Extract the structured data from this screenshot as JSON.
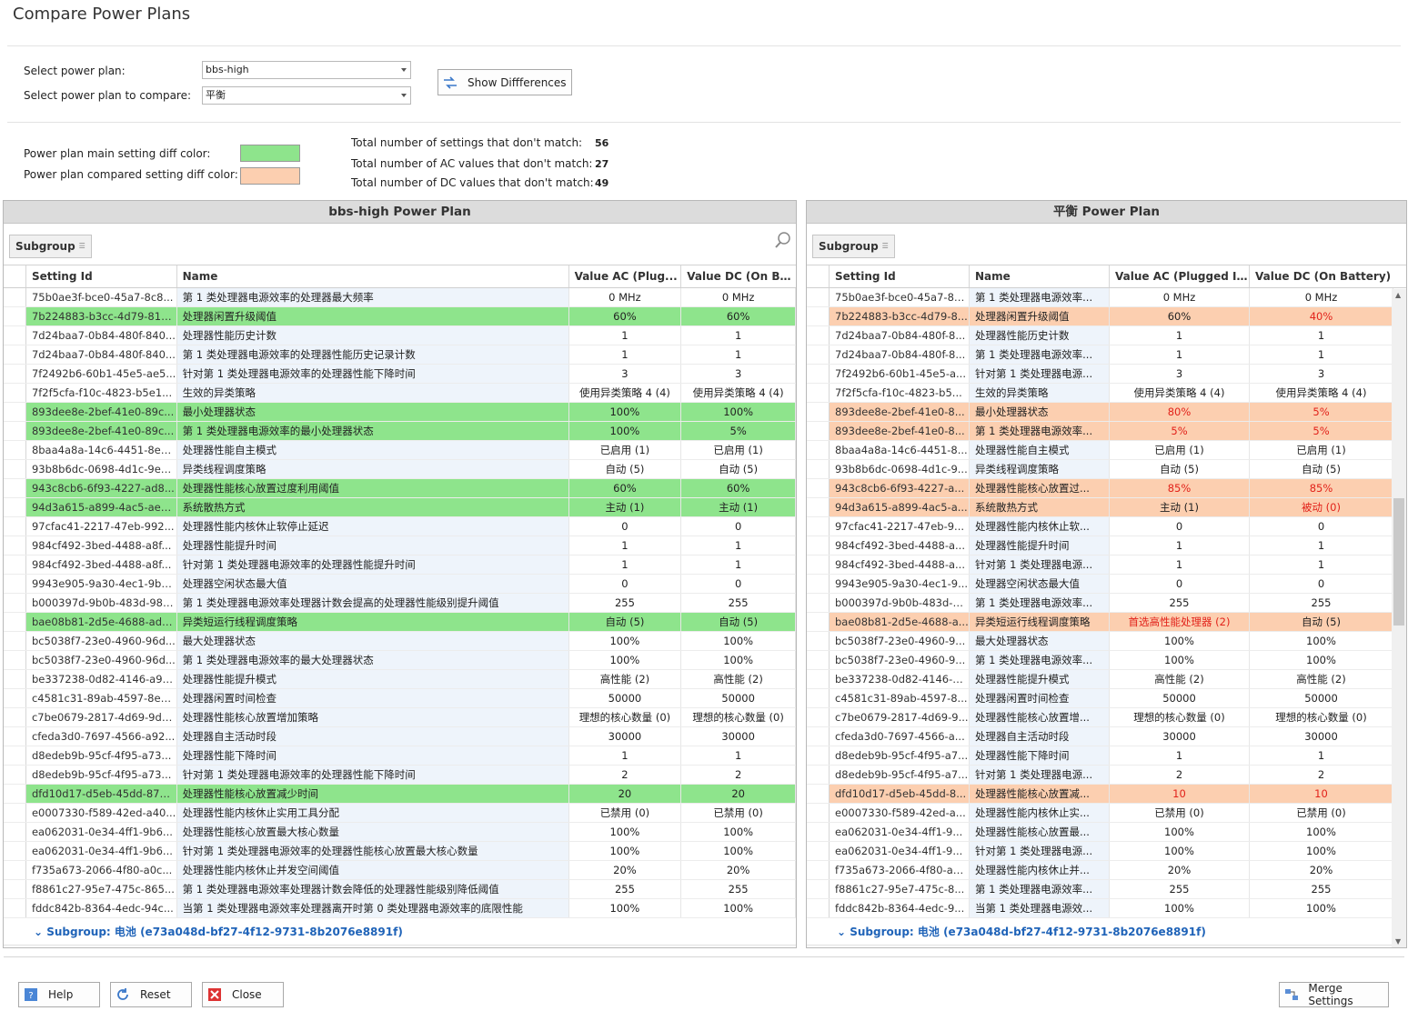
{
  "window": {
    "title": "Compare Power Plans"
  },
  "selection": {
    "plan_label": "Select power plan:",
    "plan_value": "bbs-high",
    "compare_label": "Select power plan to compare:",
    "compare_value": "平衡",
    "show_diff_label": "Show Diffferences"
  },
  "colors": {
    "main_label": "Power plan main setting diff color:",
    "main_color": "#8ee48c",
    "compared_label": "Power plan compared setting diff color:",
    "compared_color": "#fccfb0",
    "diff_value_color": "#e2221a"
  },
  "stats": {
    "settings_label": "Total number of settings that don't match:",
    "settings_value": "56",
    "ac_label": "Total number of AC values that don't match:",
    "ac_value": "27",
    "dc_label": "Total number of DC values that don't match:",
    "dc_value": "49"
  },
  "left": {
    "title": "bbs-high Power Plan",
    "subgroup_btn": "Subgroup",
    "columns": [
      "Setting Id",
      "Name",
      "Value AC (Plug...",
      "Value DC (On Bat..."
    ],
    "subgroup_footer": "Subgroup: 电池 (e73a048d-bf27-4f12-9731-8b2076e8891f)"
  },
  "right": {
    "title": "平衡 Power Plan",
    "subgroup_btn": "Subgroup",
    "columns": [
      "Setting Id",
      "Name",
      "Value AC (Plugged In)",
      "Value DC (On Battery)"
    ],
    "subgroup_footer": "Subgroup: 电池 (e73a048d-bf27-4f12-9731-8b2076e8891f)"
  },
  "rows": [
    {
      "left_id": "75b0ae3f-bce0-45a7-8c8...",
      "left_name": "第 1 类处理器电源效率的处理器最大频率",
      "right_id": "75b0ae3f-bce0-45a7-8c...",
      "right_name": "第 1 类处理器电源效率...",
      "l_ac": "0 MHz",
      "l_dc": "0 MHz",
      "r_ac": "0 MHz",
      "r_dc": "0 MHz",
      "diff": false,
      "r_ac_red": false,
      "r_dc_red": false
    },
    {
      "left_id": "7b224883-b3cc-4d79-819...",
      "left_name": "处理器闲置升级阈值",
      "right_id": "7b224883-b3cc-4d79-8...",
      "right_name": "处理器闲置升级阈值",
      "l_ac": "60%",
      "l_dc": "60%",
      "r_ac": "60%",
      "r_dc": "40%",
      "diff": true,
      "r_ac_red": false,
      "r_dc_red": true
    },
    {
      "left_id": "7d24baa7-0b84-480f-840...",
      "left_name": "处理器性能历史计数",
      "right_id": "7d24baa7-0b84-480f-8...",
      "right_name": "处理器性能历史计数",
      "l_ac": "1",
      "l_dc": "1",
      "r_ac": "1",
      "r_dc": "1",
      "diff": false,
      "r_ac_red": false,
      "r_dc_red": false
    },
    {
      "left_id": "7d24baa7-0b84-480f-840...",
      "left_name": "第 1 类处理器电源效率的处理器性能历史记录计数",
      "right_id": "7d24baa7-0b84-480f-8...",
      "right_name": "第 1 类处理器电源效率...",
      "l_ac": "1",
      "l_dc": "1",
      "r_ac": "1",
      "r_dc": "1",
      "diff": false,
      "r_ac_red": false,
      "r_dc_red": false
    },
    {
      "left_id": "7f2492b6-60b1-45e5-ae5...",
      "left_name": "针对第 1 类处理器电源效率的处理器性能下降时间",
      "right_id": "7f2492b6-60b1-45e5-a...",
      "right_name": "针对第 1 类处理器电源...",
      "l_ac": "3",
      "l_dc": "3",
      "r_ac": "3",
      "r_dc": "3",
      "diff": false,
      "r_ac_red": false,
      "r_dc_red": false
    },
    {
      "left_id": "7f2f5cfa-f10c-4823-b5e1...",
      "left_name": "生效的异类策略",
      "right_id": "7f2f5cfa-f10c-4823-b5...",
      "right_name": "生效的异类策略",
      "l_ac": "使用异类策略 4 (4)",
      "l_dc": "使用异类策略 4 (4)",
      "r_ac": "使用异类策略 4 (4)",
      "r_dc": "使用异类策略 4 (4)",
      "diff": false,
      "r_ac_red": false,
      "r_dc_red": false
    },
    {
      "left_id": "893dee8e-2bef-41e0-89c...",
      "left_name": "最小处理器状态",
      "right_id": "893dee8e-2bef-41e0-8...",
      "right_name": "最小处理器状态",
      "l_ac": "100%",
      "l_dc": "100%",
      "r_ac": "80%",
      "r_dc": "5%",
      "diff": true,
      "r_ac_red": true,
      "r_dc_red": true
    },
    {
      "left_id": "893dee8e-2bef-41e0-89c...",
      "left_name": "第 1 类处理器电源效率的最小处理器状态",
      "right_id": "893dee8e-2bef-41e0-8...",
      "right_name": "第 1 类处理器电源效率...",
      "l_ac": "100%",
      "l_dc": "5%",
      "r_ac": "5%",
      "r_dc": "5%",
      "diff": true,
      "r_ac_red": true,
      "r_dc_red": true
    },
    {
      "left_id": "8baa4a8a-14c6-4451-8e8...",
      "left_name": "处理器性能自主模式",
      "right_id": "8baa4a8a-14c6-4451-8...",
      "right_name": "处理器性能自主模式",
      "l_ac": "已启用 (1)",
      "l_dc": "已启用 (1)",
      "r_ac": "已启用 (1)",
      "r_dc": "已启用 (1)",
      "diff": false,
      "r_ac_red": false,
      "r_dc_red": false
    },
    {
      "left_id": "93b8b6dc-0698-4d1c-9ee...",
      "left_name": "异类线程调度策略",
      "right_id": "93b8b6dc-0698-4d1c-9...",
      "right_name": "异类线程调度策略",
      "l_ac": "自动 (5)",
      "l_dc": "自动 (5)",
      "r_ac": "自动 (5)",
      "r_dc": "自动 (5)",
      "diff": false,
      "r_ac_red": false,
      "r_dc_red": false
    },
    {
      "left_id": "943c8cb6-6f93-4227-ad8...",
      "left_name": "处理器性能核心放置过度利用阈值",
      "right_id": "943c8cb6-6f93-4227-a...",
      "right_name": "处理器性能核心放置过...",
      "l_ac": "60%",
      "l_dc": "60%",
      "r_ac": "85%",
      "r_dc": "85%",
      "diff": true,
      "r_ac_red": true,
      "r_dc_red": true
    },
    {
      "left_id": "94d3a615-a899-4ac5-ae2...",
      "left_name": "系统散热方式",
      "right_id": "94d3a615-a899-4ac5-a...",
      "right_name": "系统散热方式",
      "l_ac": "主动 (1)",
      "l_dc": "主动 (1)",
      "r_ac": "主动 (1)",
      "r_dc": "被动 (0)",
      "diff": true,
      "r_ac_red": false,
      "r_dc_red": true
    },
    {
      "left_id": "97cfac41-2217-47eb-992...",
      "left_name": "处理器性能内核休止软停止延迟",
      "right_id": "97cfac41-2217-47eb-9...",
      "right_name": "处理器性能内核休止软...",
      "l_ac": "0",
      "l_dc": "0",
      "r_ac": "0",
      "r_dc": "0",
      "diff": false,
      "r_ac_red": false,
      "r_dc_red": false
    },
    {
      "left_id": "984cf492-3bed-4488-a8f...",
      "left_name": "处理器性能提升时间",
      "right_id": "984cf492-3bed-4488-a...",
      "right_name": "处理器性能提升时间",
      "l_ac": "1",
      "l_dc": "1",
      "r_ac": "1",
      "r_dc": "1",
      "diff": false,
      "r_ac_red": false,
      "r_dc_red": false
    },
    {
      "left_id": "984cf492-3bed-4488-a8f...",
      "left_name": "针对第 1 类处理器电源效率的处理器性能提升时间",
      "right_id": "984cf492-3bed-4488-a...",
      "right_name": "针对第 1 类处理器电源...",
      "l_ac": "1",
      "l_dc": "1",
      "r_ac": "1",
      "r_dc": "1",
      "diff": false,
      "r_ac_red": false,
      "r_dc_red": false
    },
    {
      "left_id": "9943e905-9a30-4ec1-9b9...",
      "left_name": "处理器空闲状态最大值",
      "right_id": "9943e905-9a30-4ec1-9...",
      "right_name": "处理器空闲状态最大值",
      "l_ac": "0",
      "l_dc": "0",
      "r_ac": "0",
      "r_dc": "0",
      "diff": false,
      "r_ac_red": false,
      "r_dc_red": false
    },
    {
      "left_id": "b000397d-9b0b-483d-98c...",
      "left_name": "第 1 类处理器电源效率处理器计数会提高的处理器性能级别提升阈值",
      "right_id": "b000397d-9b0b-483d-9...",
      "right_name": "第 1 类处理器电源效率...",
      "l_ac": "255",
      "l_dc": "255",
      "r_ac": "255",
      "r_dc": "255",
      "diff": false,
      "r_ac_red": false,
      "r_dc_red": false
    },
    {
      "left_id": "bae08b81-2d5e-4688-ad6...",
      "left_name": "异类短运行线程调度策略",
      "right_id": "bae08b81-2d5e-4688-a...",
      "right_name": "异类短运行线程调度策略",
      "l_ac": "自动 (5)",
      "l_dc": "自动 (5)",
      "r_ac": "首选高性能处理器 (2)",
      "r_dc": "自动 (5)",
      "diff": true,
      "r_ac_red": true,
      "r_dc_red": false
    },
    {
      "left_id": "bc5038f7-23e0-4960-96d...",
      "left_name": "最大处理器状态",
      "right_id": "bc5038f7-23e0-4960-9...",
      "right_name": "最大处理器状态",
      "l_ac": "100%",
      "l_dc": "100%",
      "r_ac": "100%",
      "r_dc": "100%",
      "diff": false,
      "r_ac_red": false,
      "r_dc_red": false
    },
    {
      "left_id": "bc5038f7-23e0-4960-96d...",
      "left_name": "第 1 类处理器电源效率的最大处理器状态",
      "right_id": "bc5038f7-23e0-4960-9...",
      "right_name": "第 1 类处理器电源效率...",
      "l_ac": "100%",
      "l_dc": "100%",
      "r_ac": "100%",
      "r_dc": "100%",
      "diff": false,
      "r_ac_red": false,
      "r_dc_red": false
    },
    {
      "left_id": "be337238-0d82-4146-a96...",
      "left_name": "处理器性能提升模式",
      "right_id": "be337238-0d82-4146-a...",
      "right_name": "处理器性能提升模式",
      "l_ac": "高性能 (2)",
      "l_dc": "高性能 (2)",
      "r_ac": "高性能 (2)",
      "r_dc": "高性能 (2)",
      "diff": false,
      "r_ac_red": false,
      "r_dc_red": false
    },
    {
      "left_id": "c4581c31-89ab-4597-8e2...",
      "left_name": "处理器闲置时间检查",
      "right_id": "c4581c31-89ab-4597-8...",
      "right_name": "处理器闲置时间检查",
      "l_ac": "50000",
      "l_dc": "50000",
      "r_ac": "50000",
      "r_dc": "50000",
      "diff": false,
      "r_ac_red": false,
      "r_dc_red": false
    },
    {
      "left_id": "c7be0679-2817-4d69-9d0...",
      "left_name": "处理器性能核心放置增加策略",
      "right_id": "c7be0679-2817-4d69-9...",
      "right_name": "处理器性能核心放置增...",
      "l_ac": "理想的核心数量 (0)",
      "l_dc": "理想的核心数量 (0)",
      "r_ac": "理想的核心数量 (0)",
      "r_dc": "理想的核心数量 (0)",
      "diff": false,
      "r_ac_red": false,
      "r_dc_red": false
    },
    {
      "left_id": "cfeda3d0-7697-4566-a92...",
      "left_name": "处理器自主活动时段",
      "right_id": "cfeda3d0-7697-4566-a...",
      "right_name": "处理器自主活动时段",
      "l_ac": "30000",
      "l_dc": "30000",
      "r_ac": "30000",
      "r_dc": "30000",
      "diff": false,
      "r_ac_red": false,
      "r_dc_red": false
    },
    {
      "left_id": "d8edeb9b-95cf-4f95-a73...",
      "left_name": "处理器性能下降时间",
      "right_id": "d8edeb9b-95cf-4f95-a7...",
      "right_name": "处理器性能下降时间",
      "l_ac": "1",
      "l_dc": "1",
      "r_ac": "1",
      "r_dc": "1",
      "diff": false,
      "r_ac_red": false,
      "r_dc_red": false
    },
    {
      "left_id": "d8edeb9b-95cf-4f95-a73...",
      "left_name": "针对第 1 类处理器电源效率的处理器性能下降时间",
      "right_id": "d8edeb9b-95cf-4f95-a7...",
      "right_name": "针对第 1 类处理器电源...",
      "l_ac": "2",
      "l_dc": "2",
      "r_ac": "2",
      "r_dc": "2",
      "diff": false,
      "r_ac_red": false,
      "r_dc_red": false
    },
    {
      "left_id": "dfd10d17-d5eb-45dd-877...",
      "left_name": "处理器性能核心放置减少时间",
      "right_id": "dfd10d17-d5eb-45dd-8...",
      "right_name": "处理器性能核心放置减...",
      "l_ac": "20",
      "l_dc": "20",
      "r_ac": "10",
      "r_dc": "10",
      "diff": true,
      "r_ac_red": true,
      "r_dc_red": true
    },
    {
      "left_id": "e0007330-f589-42ed-a40...",
      "left_name": "处理器性能内核休止实用工具分配",
      "right_id": "e0007330-f589-42ed-a...",
      "right_name": "处理器性能内核休止实...",
      "l_ac": "已禁用 (0)",
      "l_dc": "已禁用 (0)",
      "r_ac": "已禁用 (0)",
      "r_dc": "已禁用 (0)",
      "diff": false,
      "r_ac_red": false,
      "r_dc_red": false
    },
    {
      "left_id": "ea062031-0e34-4ff1-9b6...",
      "left_name": "处理器性能核心放置最大核心数量",
      "right_id": "ea062031-0e34-4ff1-9...",
      "right_name": "处理器性能核心放置最...",
      "l_ac": "100%",
      "l_dc": "100%",
      "r_ac": "100%",
      "r_dc": "100%",
      "diff": false,
      "r_ac_red": false,
      "r_dc_red": false
    },
    {
      "left_id": "ea062031-0e34-4ff1-9b6...",
      "left_name": "针对第 1 类处理器电源效率的处理器性能核心放置最大核心数量",
      "right_id": "ea062031-0e34-4ff1-9...",
      "right_name": "针对第 1 类处理器电源...",
      "l_ac": "100%",
      "l_dc": "100%",
      "r_ac": "100%",
      "r_dc": "100%",
      "diff": false,
      "r_ac_red": false,
      "r_dc_red": false
    },
    {
      "left_id": "f735a673-2066-4f80-a0c...",
      "left_name": "处理器性能内核休止并发空间阈值",
      "right_id": "f735a673-2066-4f80-a0...",
      "right_name": "处理器性能内核休止并...",
      "l_ac": "20%",
      "l_dc": "20%",
      "r_ac": "20%",
      "r_dc": "20%",
      "diff": false,
      "r_ac_red": false,
      "r_dc_red": false
    },
    {
      "left_id": "f8861c27-95e7-475c-865...",
      "left_name": "第 1 类处理器电源效率处理器计数会降低的处理器性能级别降低阈值",
      "right_id": "f8861c27-95e7-475c-8...",
      "right_name": "第 1 类处理器电源效率...",
      "l_ac": "255",
      "l_dc": "255",
      "r_ac": "255",
      "r_dc": "255",
      "diff": false,
      "r_ac_red": false,
      "r_dc_red": false
    },
    {
      "left_id": "fddc842b-8364-4edc-94c...",
      "left_name": "当第 1 类处理器电源效率处理器离开时第 0 类处理器电源效率的底限性能",
      "right_id": "fddc842b-8364-4edc-9...",
      "right_name": "当第 1 类处理器电源效...",
      "l_ac": "100%",
      "l_dc": "100%",
      "r_ac": "100%",
      "r_dc": "100%",
      "diff": false,
      "r_ac_red": false,
      "r_dc_red": false
    }
  ],
  "footer": {
    "help": "Help",
    "reset": "Reset",
    "close": "Close",
    "merge": "Merge Settings"
  }
}
